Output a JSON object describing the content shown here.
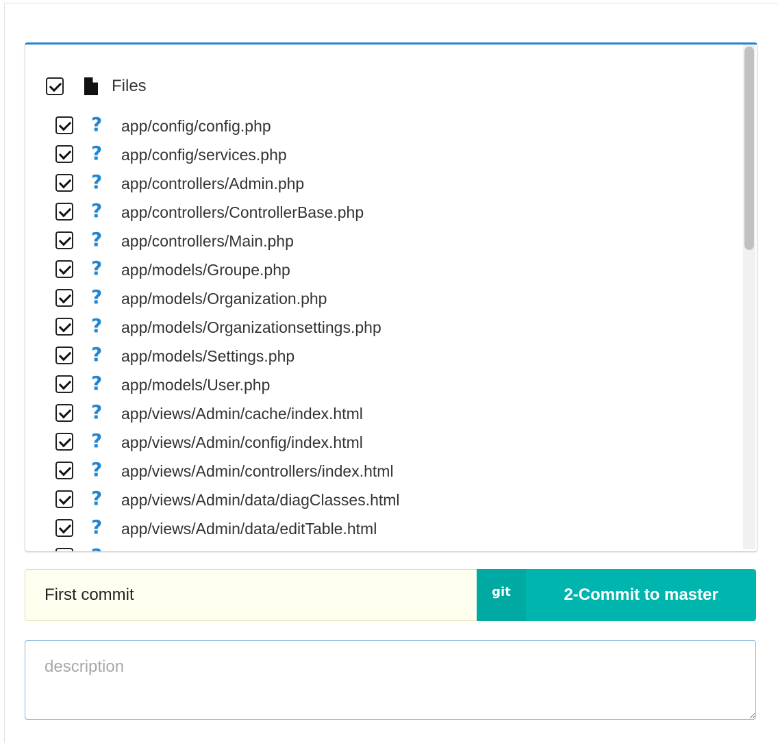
{
  "files_panel": {
    "root": {
      "label": "Files",
      "checked": true,
      "icon": "file-icon"
    },
    "files": [
      {
        "name": "app/config/config.php",
        "status_icon": "question-icon",
        "checked": true
      },
      {
        "name": "app/config/services.php",
        "status_icon": "question-icon",
        "checked": true
      },
      {
        "name": "app/controllers/Admin.php",
        "status_icon": "question-icon",
        "checked": true
      },
      {
        "name": "app/controllers/ControllerBase.php",
        "status_icon": "question-icon",
        "checked": true
      },
      {
        "name": "app/controllers/Main.php",
        "status_icon": "question-icon",
        "checked": true
      },
      {
        "name": "app/models/Groupe.php",
        "status_icon": "question-icon",
        "checked": true
      },
      {
        "name": "app/models/Organization.php",
        "status_icon": "question-icon",
        "checked": true
      },
      {
        "name": "app/models/Organizationsettings.php",
        "status_icon": "question-icon",
        "checked": true
      },
      {
        "name": "app/models/Settings.php",
        "status_icon": "question-icon",
        "checked": true
      },
      {
        "name": "app/models/User.php",
        "status_icon": "question-icon",
        "checked": true
      },
      {
        "name": "app/views/Admin/cache/index.html",
        "status_icon": "question-icon",
        "checked": true
      },
      {
        "name": "app/views/Admin/config/index.html",
        "status_icon": "question-icon",
        "checked": true
      },
      {
        "name": "app/views/Admin/controllers/index.html",
        "status_icon": "question-icon",
        "checked": true
      },
      {
        "name": "app/views/Admin/data/diagClasses.html",
        "status_icon": "question-icon",
        "checked": true
      },
      {
        "name": "app/views/Admin/data/editTable.html",
        "status_icon": "question-icon",
        "checked": true
      },
      {
        "name": "",
        "status_icon": "question-icon",
        "checked": true
      }
    ]
  },
  "commit": {
    "message_value": "First commit",
    "git_label": "git",
    "button_label": "2-Commit to master",
    "accent_color": "#00b5ad"
  },
  "description": {
    "placeholder": "description",
    "value": ""
  },
  "colors": {
    "primary": "#2185d0",
    "teal": "#00b5ad",
    "input_bg": "#fffff0"
  }
}
